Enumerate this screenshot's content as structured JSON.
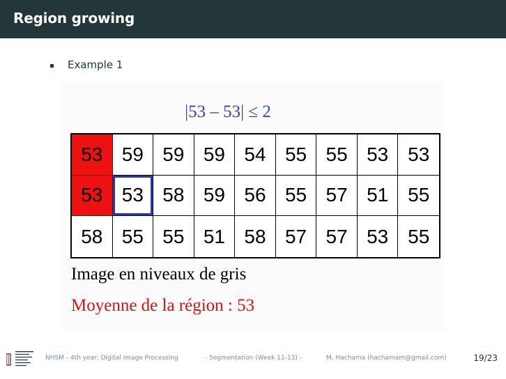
{
  "header": {
    "title": "Region growing"
  },
  "content": {
    "bullet": "Example 1",
    "formula": "|53 – 53| ≤ 2",
    "grid": [
      [
        "53",
        "59",
        "59",
        "59",
        "54",
        "55",
        "55",
        "53",
        "53"
      ],
      [
        "53",
        "53",
        "58",
        "59",
        "56",
        "55",
        "57",
        "51",
        "55"
      ],
      [
        "58",
        "55",
        "55",
        "51",
        "58",
        "57",
        "57",
        "53",
        "55"
      ]
    ],
    "caption_image": "Image en niveaux de gris",
    "caption_mean": "Moyenne de la région : 53"
  },
  "colors": {
    "header_bg": "#23373b",
    "region_red": "#ee1111",
    "selected_border": "#2c3a99",
    "formula_blue": "#3344bb"
  },
  "footer": {
    "course": "NHSM - 4th year: Digital Image Processing",
    "section": "- Segmentation (Week 11-13) -",
    "author": "M. Hachama (hachamam@gmail.com)",
    "page": "19/23"
  }
}
